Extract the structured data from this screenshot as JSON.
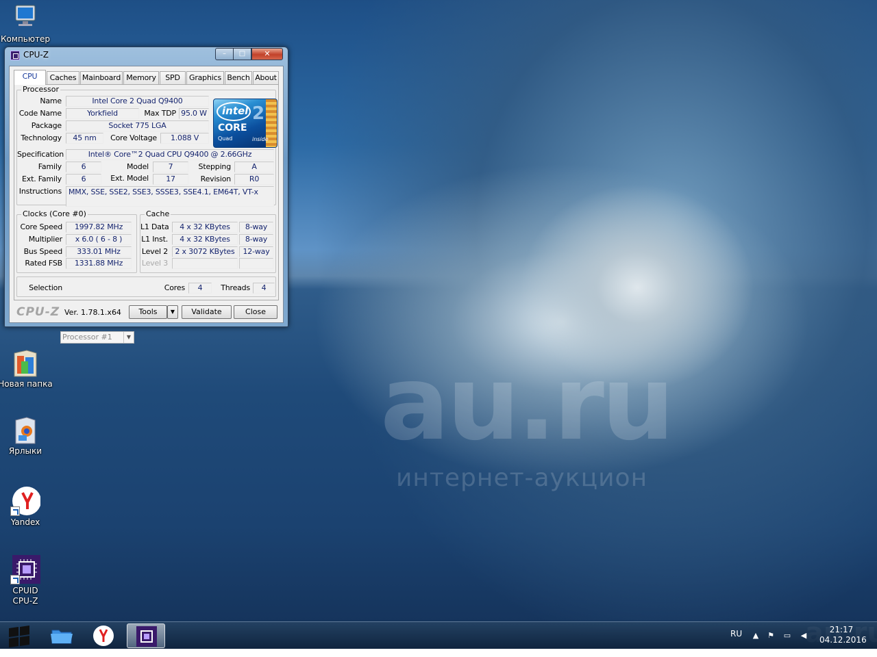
{
  "watermark": {
    "brand": "au.ru",
    "tagline": "интернет-аукцион",
    "corner": "au.ru"
  },
  "desktop_icons": [
    {
      "label": "Компьютер"
    },
    {
      "label": "Новая папка"
    },
    {
      "label": "Ярлыки"
    },
    {
      "label": "Yandex"
    },
    {
      "label": "CPUID\nCPU-Z"
    }
  ],
  "window": {
    "title": "CPU-Z",
    "min": "–",
    "max": "□",
    "close": "✕",
    "tabs": [
      "CPU",
      "Caches",
      "Mainboard",
      "Memory",
      "SPD",
      "Graphics",
      "Bench",
      "About"
    ],
    "active_tab": "CPU",
    "processor": {
      "group": "Processor",
      "name_label": "Name",
      "name": "Intel Core 2 Quad Q9400",
      "codename_label": "Code Name",
      "codename": "Yorkfield",
      "maxtdp_label": "Max TDP",
      "maxtdp": "95.0 W",
      "package_label": "Package",
      "package": "Socket 775 LGA",
      "technology_label": "Technology",
      "technology": "45 nm",
      "voltage_label": "Core Voltage",
      "voltage": "1.088 V",
      "spec_label": "Specification",
      "spec": "Intel® Core™2 Quad CPU    Q9400  @ 2.66GHz",
      "family_label": "Family",
      "family": "6",
      "model_label": "Model",
      "model": "7",
      "stepping_label": "Stepping",
      "stepping": "A",
      "extfamily_label": "Ext. Family",
      "extfamily": "6",
      "extmodel_label": "Ext. Model",
      "extmodel": "17",
      "revision_label": "Revision",
      "revision": "R0",
      "instructions_label": "Instructions",
      "instructions": "MMX, SSE, SSE2, SSE3, SSSE3, SSE4.1, EM64T, VT-x"
    },
    "logo": {
      "brand": "intel",
      "line": "CORE",
      "sub": "Quad",
      "inside": "inside",
      "num": "2"
    },
    "clocks": {
      "group": "Clocks (Core #0)",
      "corespeed_label": "Core Speed",
      "corespeed": "1997.82 MHz",
      "multiplier_label": "Multiplier",
      "multiplier": "x 6.0 ( 6 - 8 )",
      "busspeed_label": "Bus Speed",
      "busspeed": "333.01 MHz",
      "ratedfsb_label": "Rated FSB",
      "ratedfsb": "1331.88 MHz"
    },
    "cache": {
      "group": "Cache",
      "rows": [
        {
          "label": "L1 Data",
          "size": "4 x 32 KBytes",
          "way": "8-way"
        },
        {
          "label": "L1 Inst.",
          "size": "4 x 32 KBytes",
          "way": "8-way"
        },
        {
          "label": "Level 2",
          "size": "2 x 3072 KBytes",
          "way": "12-way"
        },
        {
          "label": "Level 3",
          "size": "",
          "way": ""
        }
      ]
    },
    "selection": {
      "label": "Selection",
      "value": "Processor #1",
      "cores_label": "Cores",
      "cores": "4",
      "threads_label": "Threads",
      "threads": "4"
    },
    "footer": {
      "logo": "CPU-Z",
      "version": "Ver. 1.78.1.x64",
      "tools": "Tools",
      "validate": "Validate",
      "close": "Close"
    }
  },
  "taskbar": {
    "lang": "RU",
    "time": "21:17",
    "date": "04.12.2016"
  }
}
